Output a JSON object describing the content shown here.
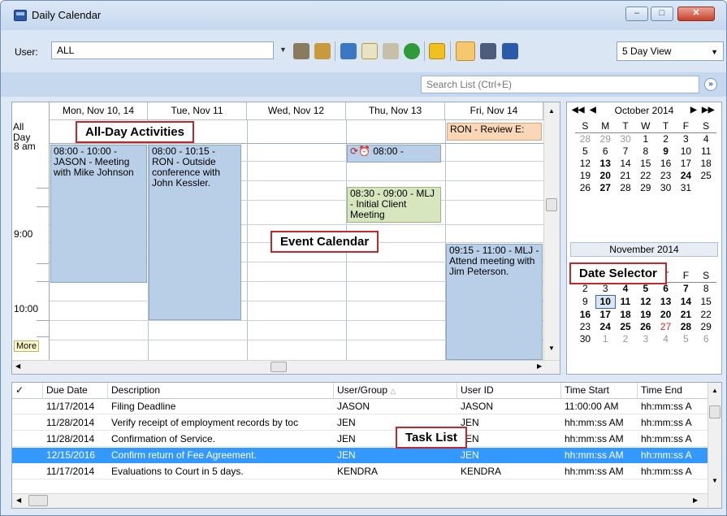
{
  "window": {
    "title": "Daily Calendar"
  },
  "toolbar": {
    "user_label": "User:",
    "user_value": "ALL",
    "view_select": "5 Day View"
  },
  "search": {
    "placeholder": "Search List (Ctrl+E)"
  },
  "calendar": {
    "allday_label": "All Day",
    "columns": [
      "Mon, Nov 10, 14",
      "Tue, Nov 11",
      "Wed, Nov 12",
      "Thu, Nov 13",
      "Fri, Nov 14"
    ],
    "times": [
      "8 am",
      "9:00",
      "10:00"
    ],
    "more_label": "More",
    "events": {
      "mon": "08:00 - 10:00 - JASON - Meeting with Mike Johnson",
      "tue": "08:00 - 10:15 - RON - Outside conference with John Kessler.",
      "thu1": "08:00 -",
      "thu2": "08:30 - 09:00 - MLJ - Initial Client Meeting",
      "fri_allday": "RON - Review E:",
      "fri": "09:15 - 11:00 - MLJ - Attend meeting with Jim Peterson."
    }
  },
  "callouts": {
    "allday": "All-Day Activities",
    "event": "Event Calendar",
    "date": "Date Selector",
    "task": "Task List"
  },
  "datepicker": {
    "month1": "October 2014",
    "month2": "November 2014",
    "weekdays": [
      "S",
      "M",
      "T",
      "W",
      "T",
      "F",
      "S"
    ],
    "oct": [
      [
        "28",
        "29",
        "30",
        "1",
        "2",
        "3",
        "4"
      ],
      [
        "5",
        "6",
        "7",
        "8",
        "9",
        "10",
        "11"
      ],
      [
        "12",
        "13",
        "14",
        "15",
        "16",
        "17",
        "18"
      ],
      [
        "19",
        "20",
        "21",
        "22",
        "23",
        "24",
        "25"
      ],
      [
        "26",
        "27",
        "28",
        "29",
        "30",
        "31",
        ""
      ]
    ],
    "nov": [
      [
        "2",
        "3",
        "4",
        "5",
        "6",
        "7",
        "8"
      ],
      [
        "9",
        "10",
        "11",
        "12",
        "13",
        "14",
        "15"
      ],
      [
        "16",
        "17",
        "18",
        "19",
        "20",
        "21",
        "22"
      ],
      [
        "23",
        "24",
        "25",
        "26",
        "27",
        "28",
        "29"
      ],
      [
        "30",
        "1",
        "2",
        "3",
        "4",
        "5",
        "6"
      ]
    ]
  },
  "tasklist": {
    "headers": [
      "✓",
      "Due Date",
      "Description",
      "User/Group",
      "User ID",
      "Time Start",
      "Time End"
    ],
    "rows": [
      [
        "11/17/2014",
        "Filing Deadline",
        "JASON",
        "JASON",
        "11:00:00 AM",
        "hh:mm:ss A"
      ],
      [
        "11/28/2014",
        "Verify receipt of employment records by toc",
        "JEN",
        "JEN",
        "hh:mm:ss AM",
        "hh:mm:ss A"
      ],
      [
        "11/28/2014",
        "Confirmation of Service.",
        "JEN",
        "JEN",
        "hh:mm:ss AM",
        "hh:mm:ss A"
      ],
      [
        "12/15/2016",
        "Confirm return of Fee Agreement.",
        "JEN",
        "JEN",
        "hh:mm:ss AM",
        "hh:mm:ss A"
      ],
      [
        "11/17/2014",
        "Evaluations to Court in 5 days.",
        "KENDRA",
        "KENDRA",
        "hh:mm:ss AM",
        "hh:mm:ss A"
      ]
    ]
  }
}
